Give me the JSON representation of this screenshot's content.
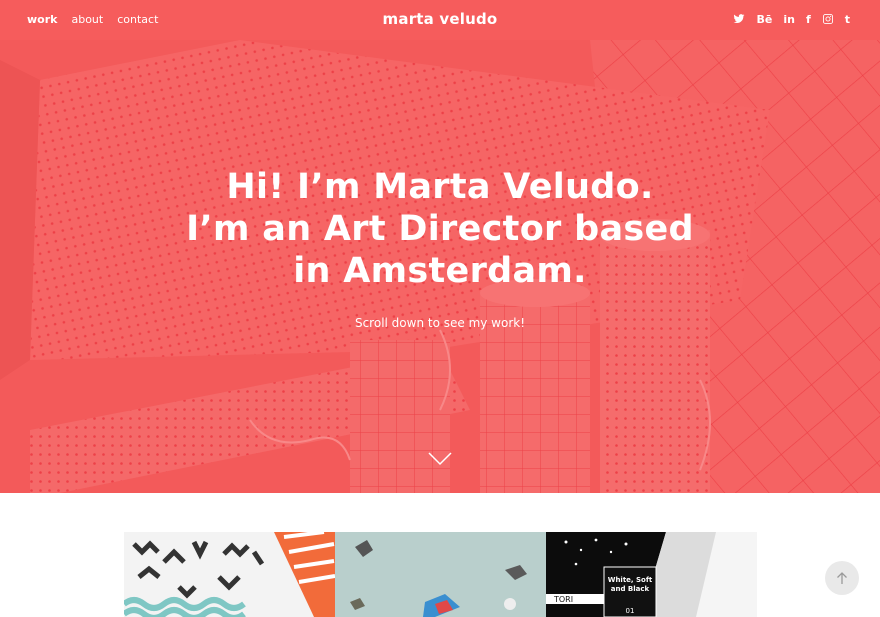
{
  "header": {
    "nav": [
      {
        "label": "work",
        "active": true
      },
      {
        "label": "about",
        "active": false
      },
      {
        "label": "contact",
        "active": false
      }
    ],
    "site_title": "marta veludo",
    "social_icons": [
      {
        "name": "twitter-icon"
      },
      {
        "name": "behance-icon",
        "label": "Bē"
      },
      {
        "name": "linkedin-icon",
        "label": "in"
      },
      {
        "name": "facebook-icon",
        "label": "f"
      },
      {
        "name": "instagram-icon"
      },
      {
        "name": "tumblr-icon",
        "label": "t"
      }
    ]
  },
  "hero": {
    "heading_lines": [
      "Hi! I’m Marta Veludo.",
      "I’m an Art Director based",
      "in Amsterdam."
    ],
    "subtext": "Scroll down to see my work!",
    "colors": {
      "accent": "#f65c5c",
      "pattern": "#e8323c"
    }
  },
  "work": {
    "thumb3_text": [
      "White, Soft",
      "and Black",
      "01"
    ],
    "thumb3_tag": "TORI"
  }
}
